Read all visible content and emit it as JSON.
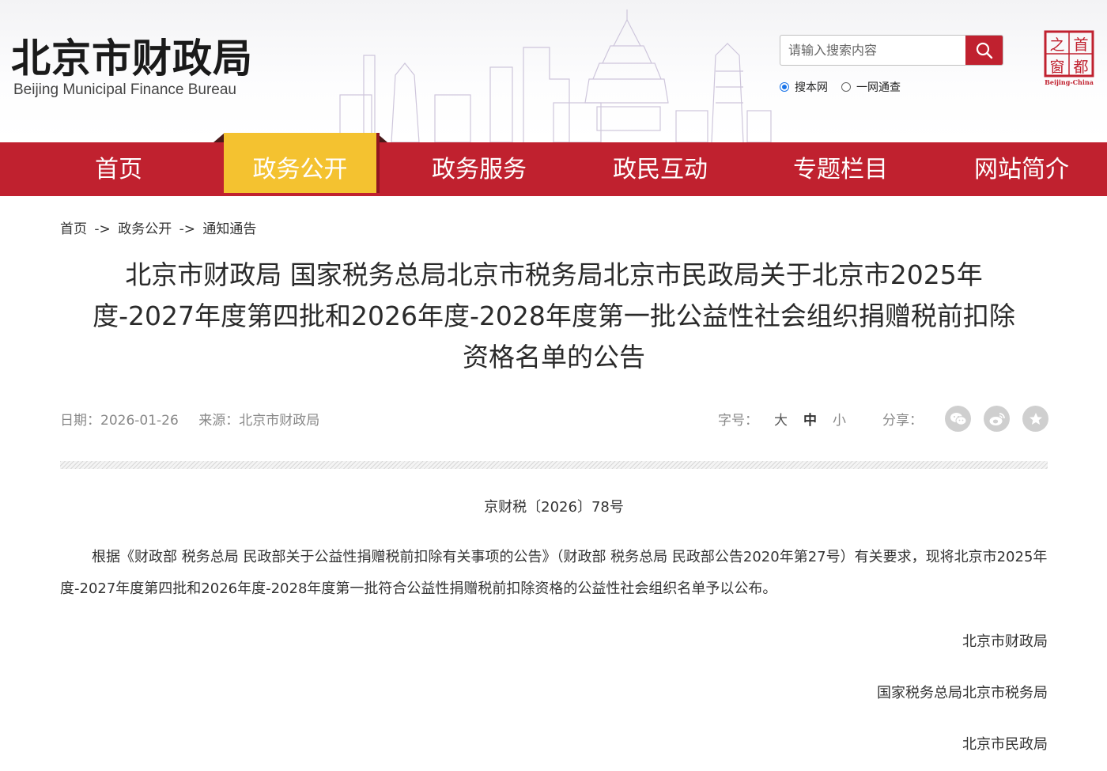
{
  "header": {
    "logo_cn": "北京市财政局",
    "logo_en": "Beijing Municipal Finance Bureau",
    "search": {
      "placeholder": "请输入搜索内容",
      "value": ""
    },
    "radios": [
      {
        "label": "搜本网",
        "checked": true
      },
      {
        "label": "一网通查",
        "checked": false
      }
    ],
    "capital_logo": {
      "chars": [
        "首",
        "都",
        "之",
        "窗"
      ],
      "caption": "Beijing-China"
    }
  },
  "nav": {
    "items": [
      {
        "label": "首页",
        "active": false
      },
      {
        "label": "政务公开",
        "active": true
      },
      {
        "label": "政务服务",
        "active": false
      },
      {
        "label": "政民互动",
        "active": false
      },
      {
        "label": "专题栏目",
        "active": false
      },
      {
        "label": "网站简介",
        "active": false
      }
    ]
  },
  "breadcrumb": {
    "items": [
      "首页",
      "政务公开",
      "通知通告"
    ],
    "separator": "->"
  },
  "article": {
    "title_lines": [
      "北京市财政局 国家税务总局北京市税务局北京市民政局关于北京市2025年",
      "度-2027年度第四批和2026年度-2028年度第一批公益性社会组织捐赠税前扣除",
      "资格名单的公告"
    ],
    "date": "日期：2026-01-26",
    "source": "来源：北京市财政局",
    "font_size_label": "字号：",
    "font_sizes": [
      "大",
      "中",
      "小"
    ],
    "current_font_size": "中",
    "share_label": "分享：",
    "share_icons": [
      "wechat-icon",
      "weibo-icon",
      "star-icon"
    ],
    "doc_number": "京财税〔2026〕78号",
    "body": "根据《财政部 税务总局 民政部关于公益性捐赠税前扣除有关事项的公告》（财政部 税务总局 民政部公告2020年第27号）有关要求，现将北京市2025年度-2027年度第四批和2026年度-2028年度第一批符合公益性捐赠税前扣除资格的公益性社会组织名单予以公布。",
    "signatures": [
      "北京市财政局",
      "国家税务总局北京市税务局",
      "北京市民政局"
    ]
  },
  "colors": {
    "brand_red": "#c0212f",
    "active_yellow": "#f4c230"
  }
}
